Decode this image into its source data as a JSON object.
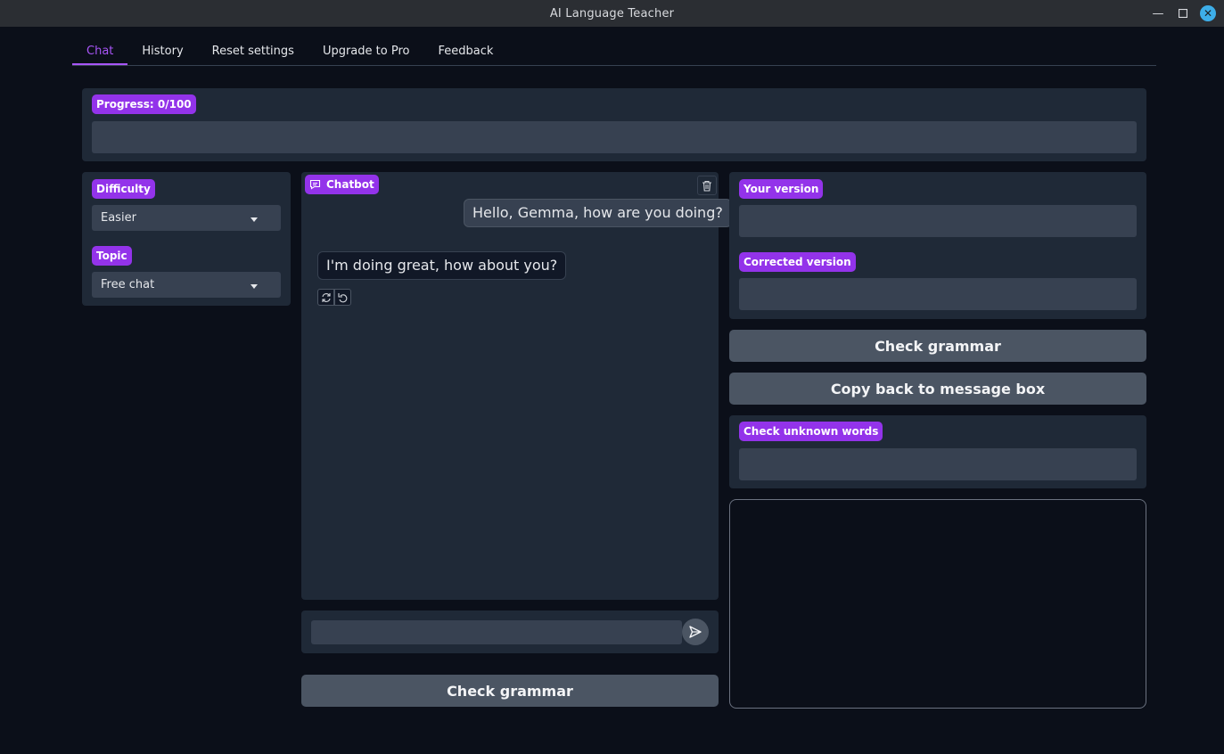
{
  "window": {
    "title": "AI Language Teacher"
  },
  "tabs": [
    {
      "label": "Chat",
      "active": true
    },
    {
      "label": "History"
    },
    {
      "label": "Reset settings"
    },
    {
      "label": "Upgrade to Pro"
    },
    {
      "label": "Feedback"
    }
  ],
  "progress": {
    "label": "Progress: 0/100",
    "value": 0,
    "max": 100
  },
  "settings": {
    "difficulty_label": "Difficulty",
    "difficulty_value": "Easier",
    "topic_label": "Topic",
    "topic_value": "Free chat"
  },
  "chatbot": {
    "label": "Chatbot",
    "messages": [
      {
        "role": "user",
        "text": "Hello, Gemma, how are you doing?"
      },
      {
        "role": "bot",
        "text": "I'm doing great, how about you?"
      }
    ],
    "input_value": ""
  },
  "grammar": {
    "your_version_label": "Your version",
    "corrected_version_label": "Corrected version",
    "check_grammar_button": "Check grammar",
    "copy_back_button": "Copy back to message box",
    "unknown_words_label": "Check unknown words",
    "check_grammar_bottom_button": "Check grammar"
  },
  "colors": {
    "accent": "#9333ea",
    "active_tab": "#a855f7",
    "background": "#0b0f19",
    "panel": "#1f2937",
    "input": "#374151",
    "button": "#4b5563"
  }
}
